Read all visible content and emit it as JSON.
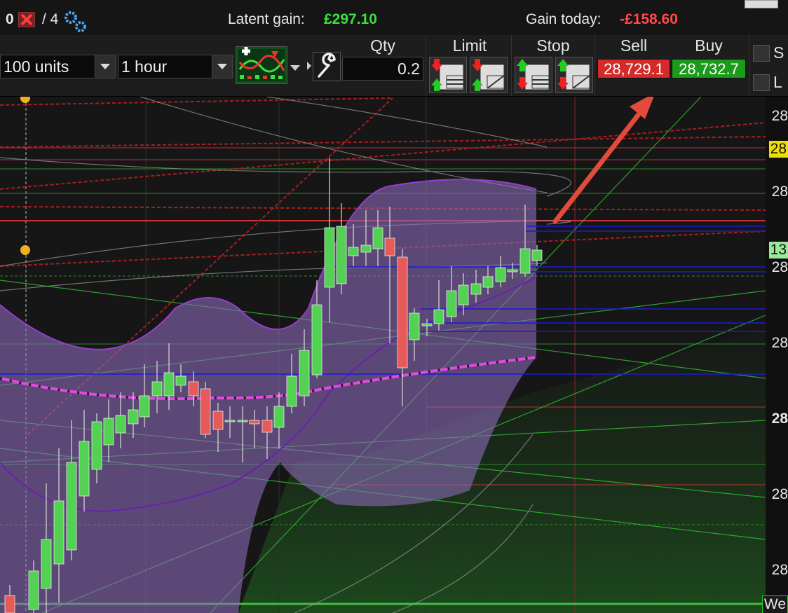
{
  "topbar": {
    "count_a": "0",
    "count_b": "/ 4",
    "latent_label": "Latent gain:",
    "latent_value": "£297.10",
    "today_label": "Gain today:",
    "today_value": "-£158.60"
  },
  "toolbar": {
    "size_select": "100 units",
    "interval_select": "1 hour",
    "qty_label": "Qty",
    "qty_value": "0.2",
    "limit_label": "Limit",
    "stop_label": "Stop",
    "sell_label": "Sell",
    "buy_label": "Buy",
    "sell_price": "28,729.1",
    "buy_price": "28,732.7",
    "check_s": "S",
    "check_l": "L"
  },
  "axis": {
    "labels": [
      "28",
      "28",
      "28",
      "13",
      "28",
      "28",
      "28",
      "28",
      "28",
      "We"
    ]
  },
  "colors": {
    "sell": "#d42a2a",
    "buy": "#1c9a1c",
    "bollinger": "#8a6ab8",
    "up_candle": "#52d152",
    "down_candle": "#e65a5a"
  }
}
